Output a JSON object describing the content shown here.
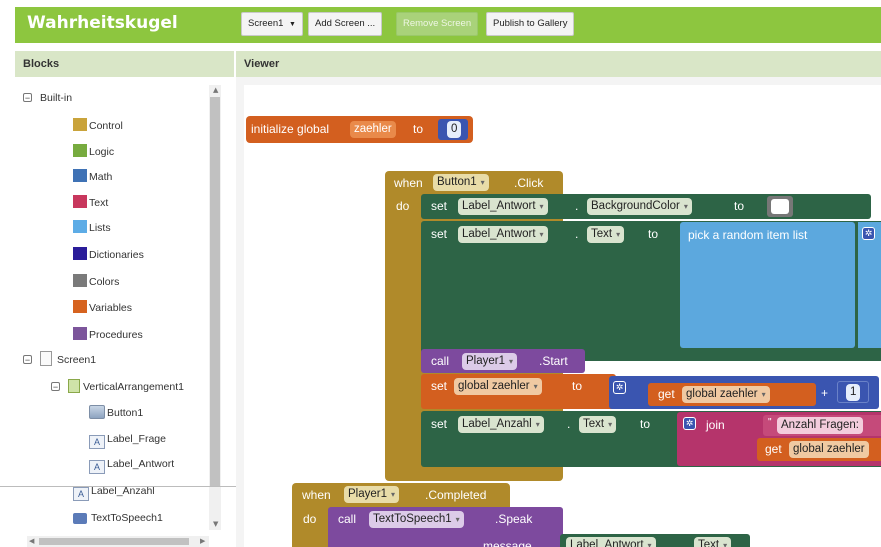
{
  "app": {
    "title": "Wahrheitskugel",
    "toolbar": {
      "screen_select": "Screen1",
      "add_screen": "Add Screen ...",
      "remove_screen": "Remove Screen",
      "publish": "Publish to Gallery"
    }
  },
  "blocks_panel": {
    "header": "Blocks",
    "builtin_label": "Built-in",
    "builtin_items": [
      {
        "label": "Control",
        "color": "#c9a33b"
      },
      {
        "label": "Logic",
        "color": "#77ab3f"
      },
      {
        "label": "Math",
        "color": "#3f72b5"
      },
      {
        "label": "Text",
        "color": "#c8375d"
      },
      {
        "label": "Lists",
        "color": "#5dace6"
      },
      {
        "label": "Dictionaries",
        "color": "#2a1d9a"
      },
      {
        "label": "Colors",
        "color": "#7a7a7a"
      },
      {
        "label": "Variables",
        "color": "#d6631f"
      },
      {
        "label": "Procedures",
        "color": "#7c559b"
      }
    ],
    "screen_label": "Screen1",
    "arrangement_label": "VerticalArrangement1",
    "components": [
      "Button1",
      "Label_Frage",
      "Label_Antwort"
    ],
    "other_components": [
      "Label_Anzahl",
      "TextToSpeech1"
    ]
  },
  "viewer": {
    "header": "Viewer",
    "init_global": {
      "kw": "initialize global",
      "name": "zaehler",
      "to": "to",
      "value": "0"
    },
    "button_event": {
      "when": "when",
      "component": "Button1",
      "event": ".Click",
      "do": "do",
      "set1": {
        "set": "set",
        "component": "Label_Antwort",
        "dot": ".",
        "property": "BackgroundColor",
        "to": "to"
      },
      "set2": {
        "set": "set",
        "component": "Label_Antwort",
        "dot": ".",
        "property": "Text",
        "to": "to",
        "value_block": "pick a random item  list"
      },
      "call_player": {
        "call": "call",
        "component": "Player1",
        "method": ".Start"
      },
      "set_global": {
        "set": "set",
        "name": "global zaehler",
        "to": "to",
        "get": "get",
        "get_name": "global zaehler",
        "plus": "+",
        "number": "1"
      },
      "set3": {
        "set": "set",
        "component": "Label_Anzahl",
        "dot": ".",
        "property": "Text",
        "to": "to",
        "join": "join",
        "string": "Anzahl Fragen:",
        "get": "get",
        "get_name": "global zaehler"
      }
    },
    "player_event": {
      "when": "when",
      "component": "Player1",
      "event": ".Completed",
      "do": "do",
      "call": "call",
      "call_component": "TextToSpeech1",
      "method": ".Speak",
      "param": "message",
      "param_component": "Label_Antwort",
      "param_property": "Text"
    }
  }
}
